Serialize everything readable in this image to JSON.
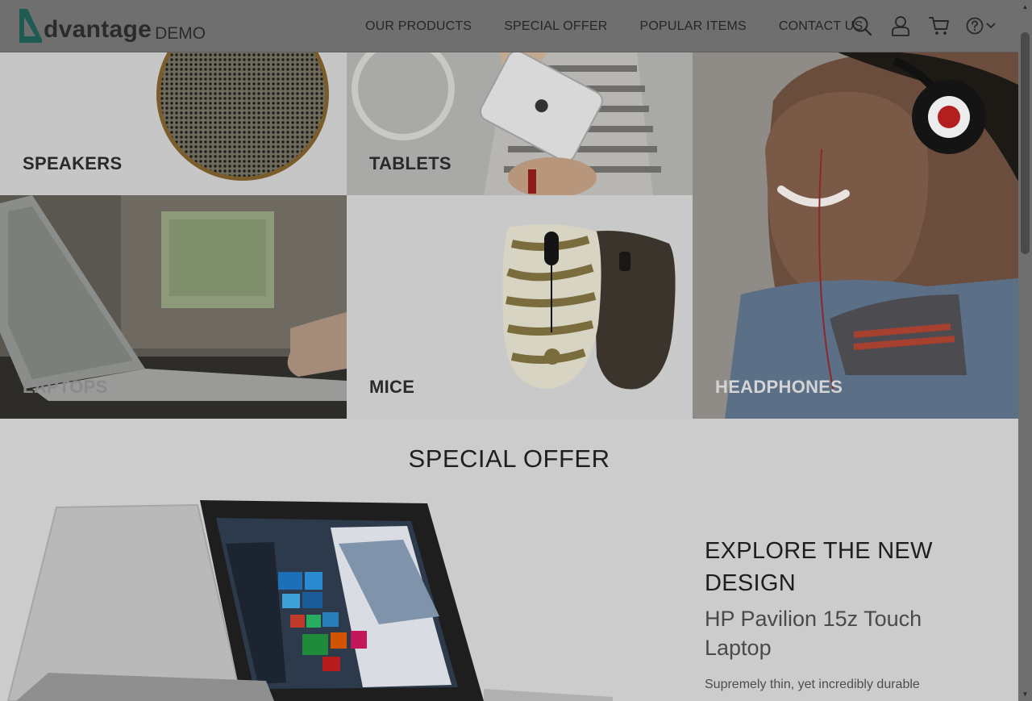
{
  "brand": {
    "word": "dvantage",
    "suffix": "DEMO",
    "accent": "#1f6a60"
  },
  "nav": {
    "items": [
      "OUR PRODUCTS",
      "SPECIAL OFFER",
      "POPULAR ITEMS",
      "CONTACT US"
    ],
    "icons": [
      "search-icon",
      "user-icon",
      "cart-icon",
      "help-icon",
      "chevron-down-icon"
    ]
  },
  "categories": {
    "speakers": "SPEAKERS",
    "tablets": "TABLETS",
    "laptops": "LAPTOPS",
    "mice": "MICE",
    "headphones": "HEADPHONES"
  },
  "special_offer": {
    "title": "SPECIAL OFFER",
    "heading": "EXPLORE THE NEW DESIGN",
    "product": "HP Pavilion 15z Touch Laptop",
    "description": "Supremely thin, yet incredibly durable"
  },
  "colors": {
    "overlay_dim": "#6f6f6f",
    "text_dark": "#262626"
  }
}
